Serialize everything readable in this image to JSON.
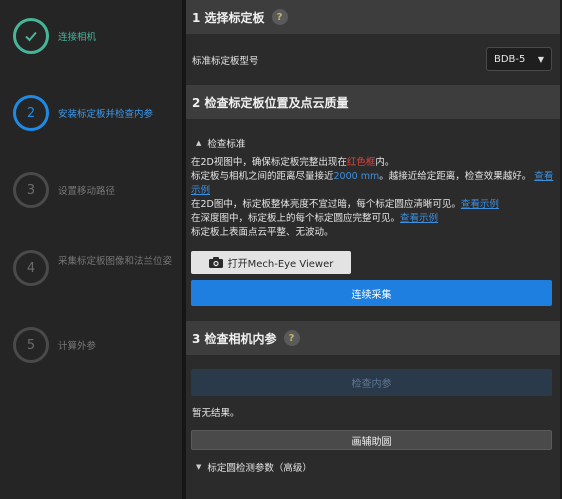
{
  "steps": [
    {
      "number": "",
      "label": "连接相机",
      "state": "done"
    },
    {
      "number": "2",
      "label": "安装标定板并检查内参",
      "state": "active"
    },
    {
      "number": "3",
      "label": "设置移动路径",
      "state": "pending"
    },
    {
      "number": "4",
      "label": "采集标定板图像和法兰位姿",
      "state": "pending"
    },
    {
      "number": "5",
      "label": "计算外参",
      "state": "pending"
    }
  ],
  "section1": {
    "title": "1 选择标定板",
    "help": "?",
    "board_model_label": "标准标定板型号",
    "board_model_value": "BDB-5"
  },
  "section2": {
    "title": "2 检查标定板位置及点云质量",
    "criteria_toggle": "检查标准",
    "line1_a": "在2D视图中，确保标定板完整出现在",
    "line1_red": "红色框",
    "line1_b": "内。",
    "line2_a": "标定板与相机之间的距离尽量接近",
    "line2_blue": "2000 mm",
    "line2_b": "。越接近给定距离，检查效果越好。",
    "link_example": "查看示例",
    "line3_a": "在2D图中，标定板整体亮度不宜过暗，每个标定圆应清晰可见。",
    "line4_a": "在深度图中，标定板上的每个标定圆应完整可见。",
    "line5": "标定板上表面点云平整、无波动。",
    "open_viewer_button": "打开Mech-Eye Viewer",
    "continuous_capture_button": "连续采集"
  },
  "section3": {
    "title": "3 检查相机内参",
    "help": "?",
    "check_button": "检查内参",
    "result_text": "暂无结果。",
    "draw_circle_button": "画辅助圆",
    "advanced_toggle": "标定圆检测参数（高级）"
  },
  "colors": {
    "done": "#46b69a",
    "active": "#1f8ae4",
    "accent_blue": "#1f7fe0",
    "highlight_red": "#e0453f"
  }
}
